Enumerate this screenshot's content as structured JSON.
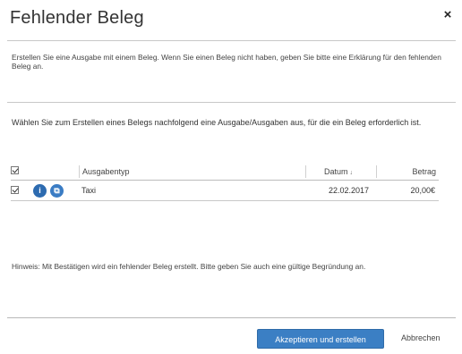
{
  "dialog": {
    "title": "Fehlender Beleg",
    "close_symbol": "×"
  },
  "intro": {
    "text": "Erstellen Sie eine Ausgabe mit einem Beleg. Wenn Sie einen Beleg nicht haben, geben Sie bitte eine Erklärung für den fehlenden Beleg an."
  },
  "instruction": {
    "text": "Wählen Sie zum Erstellen eines Belegs nachfolgend eine Ausgabe/Ausgaben aus, für die ein Beleg erforderlich ist."
  },
  "table": {
    "columns": {
      "ausgabe": "Ausgabentyp",
      "datum": "Datum",
      "betrag": "Betrag",
      "sort_indicator": "↓"
    },
    "rows": [
      {
        "checked": true,
        "ausgabe": "Taxi",
        "datum": "22.02.2017",
        "betrag": "20,00€",
        "icons": [
          "info-icon",
          "copy-icon"
        ]
      }
    ]
  },
  "footer_note": {
    "text": "Hinweis: Mit Bestätigen wird ein fehlender Beleg erstellt. Bitte geben Sie auch eine gültige Begründung an."
  },
  "actions": {
    "primary_label": "Akzeptieren und erstellen",
    "secondary_label": "Abbrechen"
  },
  "colors": {
    "primary_button": "#3b7fc4",
    "row_icon": "#2d6bb0"
  }
}
